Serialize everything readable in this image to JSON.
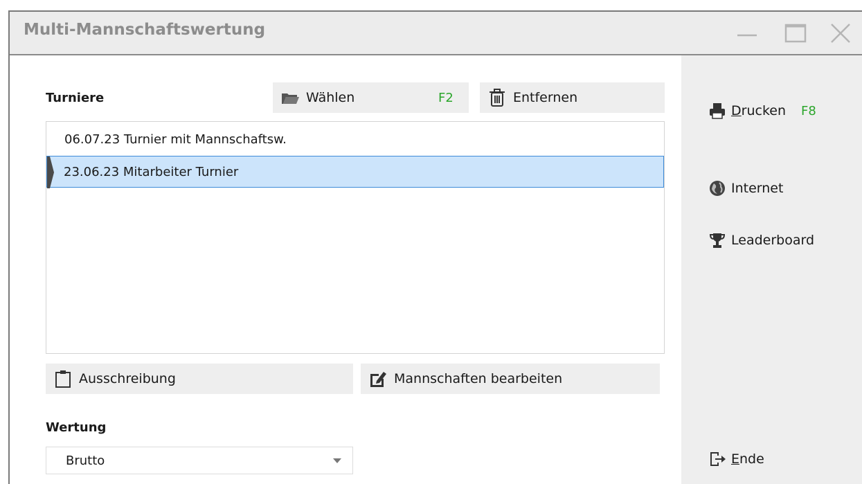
{
  "window": {
    "title": "Multi-Mannschaftswertung",
    "controls": [
      "minimize-icon",
      "maximize-icon",
      "close-icon"
    ]
  },
  "turniere": {
    "label": "Turniere",
    "choose_button": {
      "label": "Wählen",
      "shortcut": "F2",
      "icon": "folder-open-icon"
    },
    "remove_button": {
      "label": "Entfernen",
      "icon": "trash-icon"
    },
    "items": [
      {
        "label": "06.07.23 Turnier mit Mannschaftsw.",
        "selected": false
      },
      {
        "label": "23.06.23 Mitarbeiter Turnier",
        "selected": true
      }
    ]
  },
  "actions": {
    "ausschreibung": {
      "label": "Ausschreibung",
      "icon": "clipboard-icon"
    },
    "mannschaften": {
      "label": "Mannschaften bearbeiten",
      "icon": "edit-icon"
    }
  },
  "wertung": {
    "label": "Wertung",
    "selected": "Brutto"
  },
  "sidebar": {
    "drucken": {
      "label_underline": "D",
      "label_rest": "rucken",
      "shortcut": "F8",
      "icon": "printer-icon"
    },
    "internet": {
      "label": "Internet",
      "icon": "globe-icon"
    },
    "leaderboard": {
      "label": "Leaderboard",
      "icon": "trophy-icon"
    },
    "ende": {
      "label_underline": "E",
      "label_rest": "nde",
      "icon": "exit-icon"
    }
  },
  "colors": {
    "accent_green": "#2aa52a",
    "selection_bg": "#cce4fb",
    "selection_border": "#3c8ad8",
    "panel_bg": "#eeeeee"
  }
}
